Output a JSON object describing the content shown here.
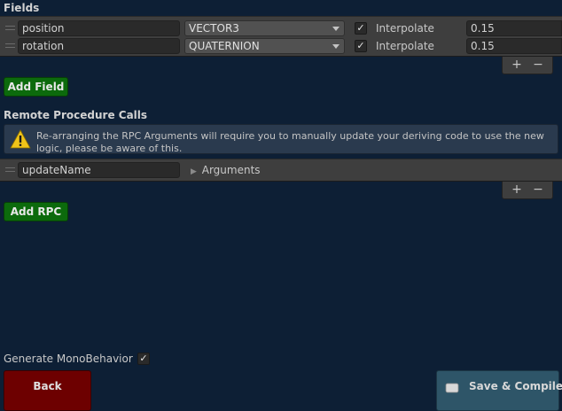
{
  "fields": {
    "title": "Fields",
    "rows": [
      {
        "name": "position",
        "type": "VECTOR3",
        "interpolate_checked": true,
        "interpolate_label": "Interpolate",
        "interpolate_value": "0.15"
      },
      {
        "name": "rotation",
        "type": "QUATERNION",
        "interpolate_checked": true,
        "interpolate_label": "Interpolate",
        "interpolate_value": "0.15"
      }
    ],
    "add_label": "Add Field",
    "plus": "+",
    "minus": "−"
  },
  "rpc": {
    "title": "Remote Procedure Calls",
    "warning": "Re-arranging the RPC Arguments will require you to manually update your deriving code to use the new logic, please be aware of this.",
    "rows": [
      {
        "name": "updateName",
        "arguments_label": "Arguments"
      }
    ],
    "add_label": "Add RPC",
    "plus": "+",
    "minus": "−"
  },
  "footer": {
    "generate_label": "Generate MonoBehavior",
    "generate_checked": true,
    "back_label": "Back",
    "save_label": "Save & Compile"
  },
  "colors": {
    "background": "#0d1f35",
    "green_button": "#0c6a0c",
    "back_button": "#6d0000",
    "save_button": "#2e5568",
    "warning_icon": "#f0c419"
  },
  "icons": {
    "check": "✓",
    "arrow": "▶"
  }
}
